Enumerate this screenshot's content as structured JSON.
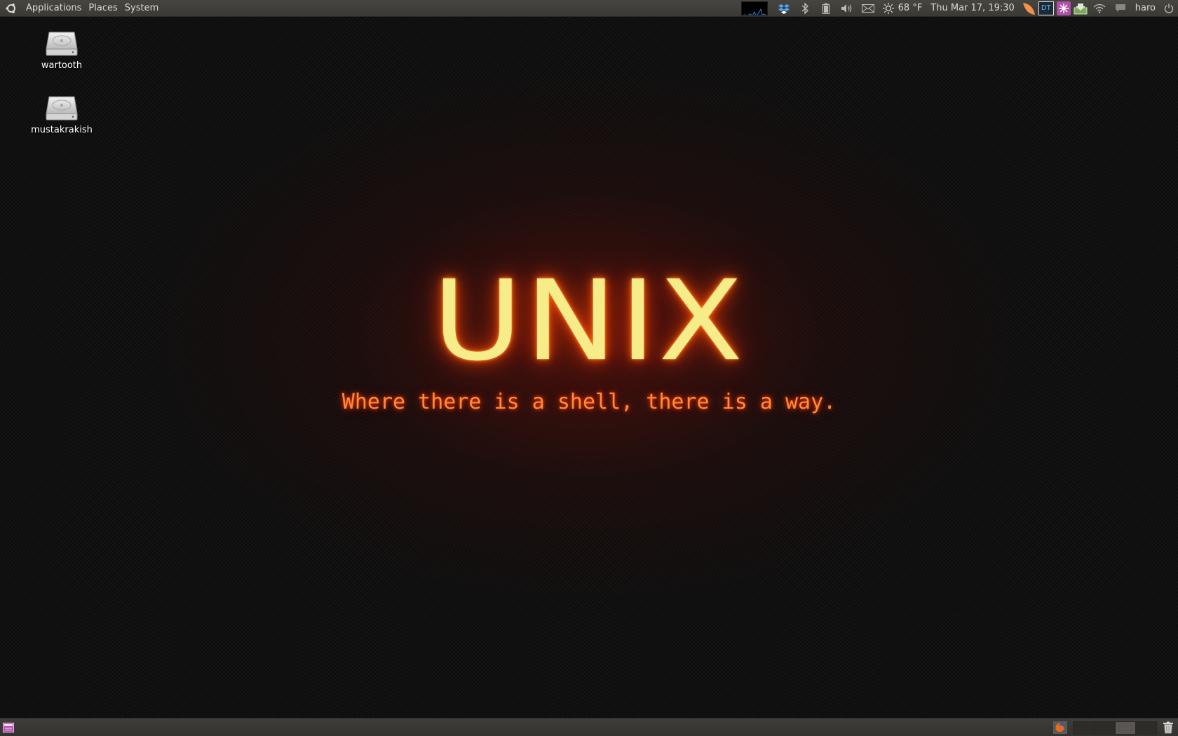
{
  "top_panel": {
    "menus": [
      "Applications",
      "Places",
      "System"
    ],
    "weather": "68 °F",
    "clock": "Thu Mar 17, 19:30",
    "user": "haro",
    "tray_icons": [
      "system-monitor-icon",
      "dropbox-icon",
      "bluetooth-icon",
      "battery-icon",
      "volume-icon",
      "mail-icon",
      "weather-sun-icon",
      "dt-applet-icon",
      "pink-applet-icon",
      "download-applet-icon",
      "wifi-icon",
      "chat-icon",
      "power-icon"
    ],
    "dt_label": "DT"
  },
  "desktop": {
    "icons": [
      {
        "label": "wartooth",
        "icon": "drive-icon"
      },
      {
        "label": "mustakrakish",
        "icon": "drive-icon"
      }
    ],
    "wallpaper": {
      "title": "UNIX",
      "tagline": "Where there is a shell, there is a way."
    }
  },
  "bottom_panel": {
    "workspaces": [
      false,
      false,
      true,
      false
    ],
    "icons": [
      "show-desktop-icon",
      "firefox-icon",
      "trash-icon"
    ]
  },
  "colors": {
    "panel": "#3c3b37",
    "title_glow": "#ff5a10",
    "title_fill": "#f7ec8a",
    "tagline": "#ff8b36"
  }
}
